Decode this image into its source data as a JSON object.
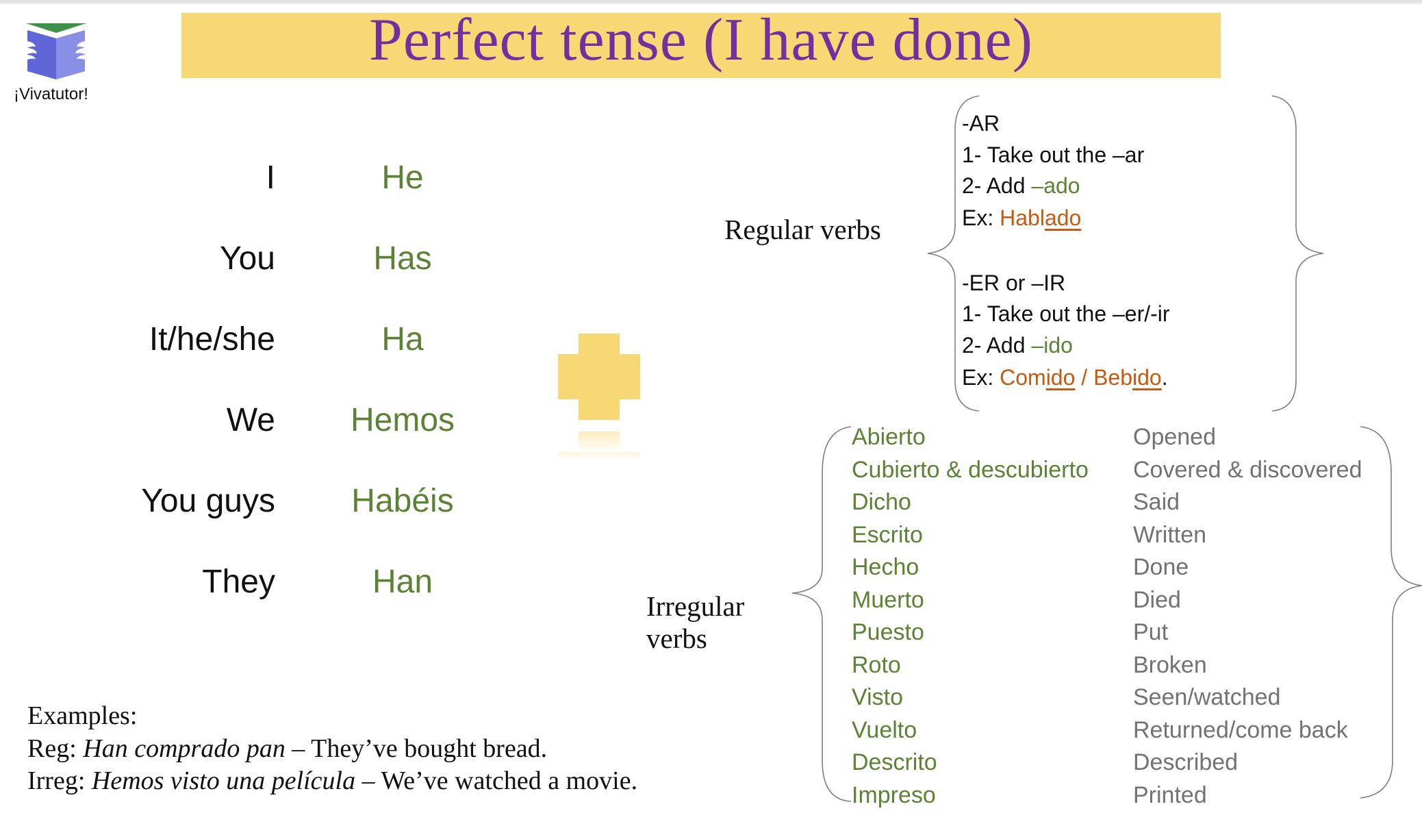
{
  "logo": {
    "icon": "book-reader-icon",
    "text": "¡Vivatutor!"
  },
  "title": "Perfect tense (I have done)",
  "conjugation": [
    {
      "pronoun": "I",
      "form": "He"
    },
    {
      "pronoun": "You",
      "form": "Has"
    },
    {
      "pronoun": "It/he/she",
      "form": "Ha"
    },
    {
      "pronoun": "We",
      "form": "Hemos"
    },
    {
      "pronoun": "You guys",
      "form": "Habéis"
    },
    {
      "pronoun": "They",
      "form": "Han"
    }
  ],
  "plus_icon": "plus-icon",
  "regular": {
    "label": "Regular verbs",
    "ar": {
      "heading": "-AR",
      "step1": "1- Take out the –ar",
      "step2_prefix": "2- Add ",
      "step2_suffix": "–ado",
      "ex_prefix": "Ex: ",
      "ex_stem": "Habl",
      "ex_ending": "ado"
    },
    "er_ir": {
      "heading": "-ER or –IR",
      "step1": "1- Take out the –er/-ir",
      "step2_prefix": "2- Add ",
      "step2_suffix": "–ido",
      "ex_prefix": "Ex: ",
      "ex1_stem": "Com",
      "ex1_ending": "ido",
      "ex_sep": " / ",
      "ex2_stem": "Beb",
      "ex2_ending": "ido",
      "ex_end": "."
    }
  },
  "irregular": {
    "label_line1": "Irregular",
    "label_line2": "verbs",
    "items": [
      {
        "verb": "Abierto",
        "translation": "Opened"
      },
      {
        "verb": "Cubierto & descubierto",
        "translation": "Covered & discovered"
      },
      {
        "verb": "Dicho",
        "translation": "Said"
      },
      {
        "verb": "Escrito",
        "translation": "Written"
      },
      {
        "verb": "Hecho",
        "translation": "Done"
      },
      {
        "verb": "Muerto",
        "translation": "Died"
      },
      {
        "verb": "Puesto",
        "translation": "Put"
      },
      {
        "verb": "Roto",
        "translation": "Broken"
      },
      {
        "verb": "Visto",
        "translation": "Seen/watched"
      },
      {
        "verb": "Vuelto",
        "translation": "Returned/come back"
      },
      {
        "verb": "Descrito",
        "translation": "Described"
      },
      {
        "verb": "Impreso",
        "translation": "Printed"
      }
    ]
  },
  "examples": {
    "heading": "Examples:",
    "reg_prefix": "Reg: ",
    "reg_spanish": "Han comprado pan",
    "reg_english": " – They’ve bought bread.",
    "irreg_prefix": "Irreg: ",
    "irreg_spanish": "Hemos visto una película",
    "irreg_english": " – We’ve watched a movie."
  },
  "colors": {
    "banner": "#f7d875",
    "title": "#7030a0",
    "green": "#5b8235",
    "orange": "#c55a11",
    "gray": "#767171"
  }
}
